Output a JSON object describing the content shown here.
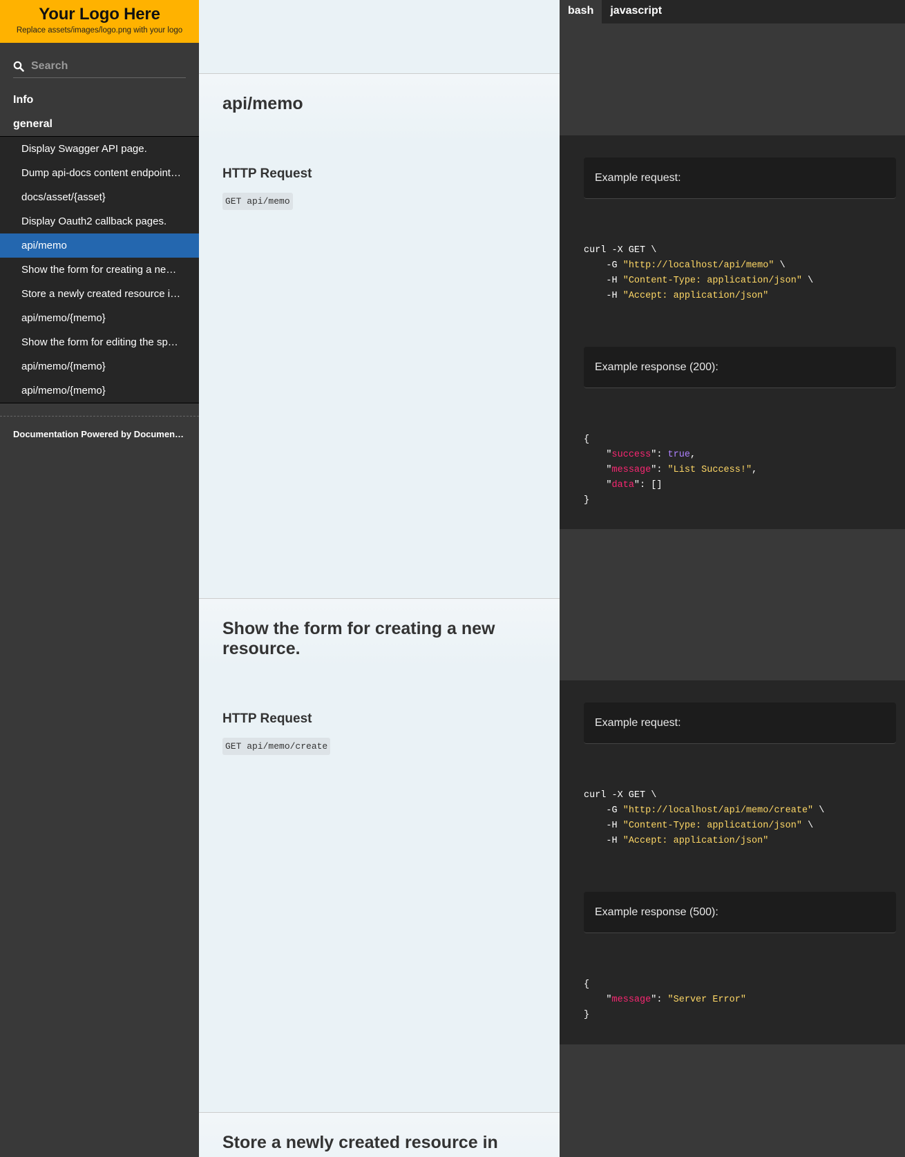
{
  "logo": {
    "title": "Your Logo Here",
    "subtitle": "Replace assets/images/logo.png with your logo",
    "brand_color": "#ffb200"
  },
  "search": {
    "placeholder": "Search",
    "icon": "search-icon"
  },
  "toc": {
    "info": "Info",
    "general": "general",
    "items": [
      "Display Swagger API page.",
      "Dump api-docs content endpoint. Supports both json and yaml",
      "docs/asset/{asset}",
      "Display Oauth2 callback pages.",
      "api/memo",
      "Show the form for creating a new resource.",
      "Store a newly created resource in storage.",
      "api/memo/{memo}",
      "Show the form for editing the specified resource.",
      "api/memo/{memo}",
      "api/memo/{memo}"
    ],
    "active_index": 4,
    "active_color": "#2467af",
    "footer": "Documentation Powered by Documentarian"
  },
  "lang_tabs": [
    "bash",
    "javascript"
  ],
  "sections": [
    {
      "title": "api/memo",
      "http_heading": "HTTP Request",
      "request": "GET api/memo",
      "example_request_label": "Example request:",
      "curl": {
        "line1": "curl -X GET \\",
        "g_flag": "-G ",
        "url": "\"http://localhost/api/memo\"",
        "g_tail": " \\",
        "h_flag": "-H ",
        "content_type": "\"Content-Type: application/json\"",
        "h_tail": " \\",
        "accept": "\"Accept: application/json\""
      },
      "example_response_label": "Example response (200):",
      "response": {
        "success_key": "success",
        "success_val": "true",
        "message_key": "message",
        "message_val": "\"List Success!\"",
        "data_key": "data",
        "data_val": "[]"
      }
    },
    {
      "title": "Show the form for creating a new resource.",
      "http_heading": "HTTP Request",
      "request": "GET api/memo/create",
      "example_request_label": "Example request:",
      "curl": {
        "line1": "curl -X GET \\",
        "g_flag": "-G ",
        "url": "\"http://localhost/api/memo/create\"",
        "g_tail": " \\",
        "h_flag": "-H ",
        "content_type": "\"Content-Type: application/json\"",
        "h_tail": " \\",
        "accept": "\"Accept: application/json\""
      },
      "example_response_label": "Example response (500):",
      "response": {
        "message_key": "message",
        "message_val": "\"Server Error\""
      }
    },
    {
      "title": "Store a newly created resource in"
    }
  ]
}
